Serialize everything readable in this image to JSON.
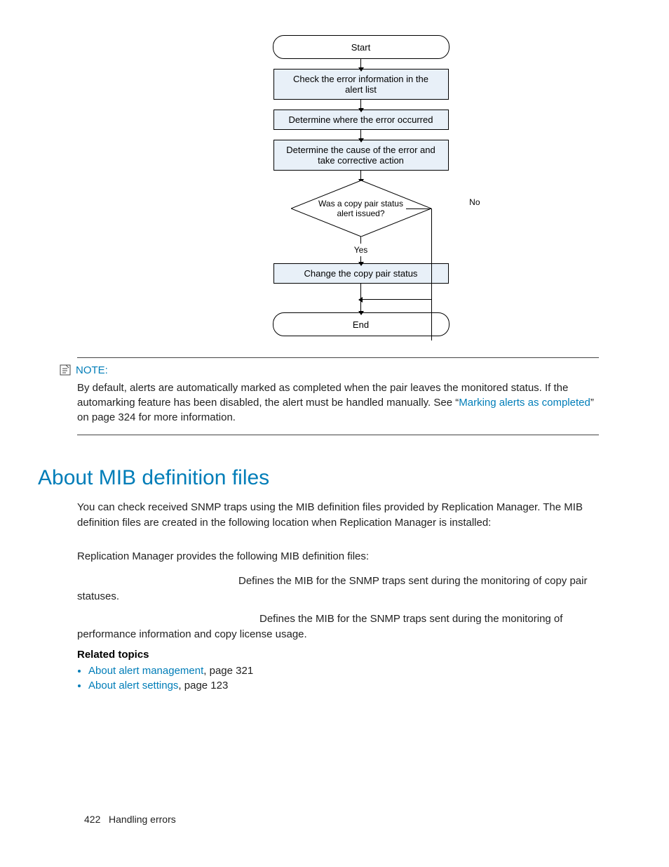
{
  "flowchart": {
    "start": "Start",
    "step1": "Check the error information in the\nalert list",
    "step2": "Determine where the error occurred",
    "step3": "Determine the cause of the error and\ntake corrective action",
    "decision_line1": "Was a copy pair status",
    "decision_line2": "alert issued?",
    "no": "No",
    "yes": "Yes",
    "step4": "Change the copy pair status",
    "end": "End"
  },
  "note": {
    "label": "NOTE:",
    "body_pre": "By default, alerts are automatically marked as completed when the pair leaves the monitored status. If the automarking feature has been disabled, the alert must be handled manually. See “",
    "link": "Marking alerts as completed",
    "body_post": "” on page 324 for more information."
  },
  "section": {
    "heading": "About MIB definition files",
    "p1": "You can check received SNMP traps using the MIB definition files provided by Replication Manager. The MIB definition files are created in the following location when Replication Manager is installed:",
    "p2": "Replication Manager provides the following MIB definition files:",
    "def1": "Defines the MIB for the SNMP traps sent during the monitoring of copy pair statuses.",
    "def2": "Defines the MIB for the SNMP traps sent during the monitoring of performance information and copy license usage.",
    "related_heading": "Related topics",
    "related": [
      {
        "link": "About alert management",
        "page": ", page 321"
      },
      {
        "link": "About alert settings",
        "page": ", page 123"
      }
    ]
  },
  "footer": {
    "page": "422",
    "chapter": "Handling errors"
  }
}
